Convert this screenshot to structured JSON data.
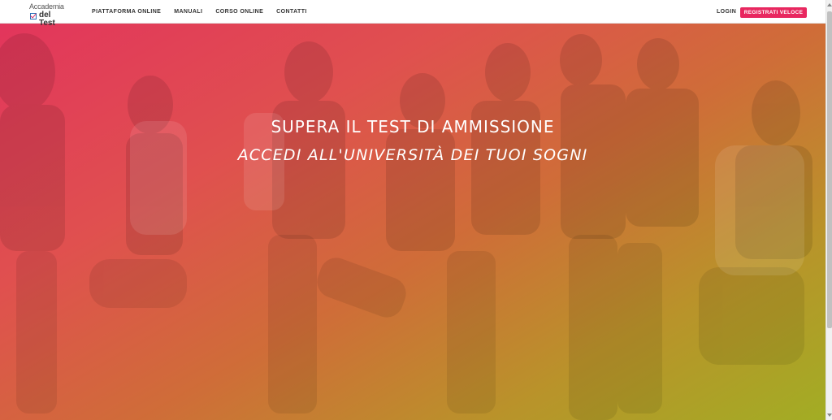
{
  "header": {
    "logo": {
      "line1": "Accademia",
      "line2": "del Test"
    },
    "nav": [
      {
        "label": "PIATTAFORMA ONLINE"
      },
      {
        "label": "MANUALI"
      },
      {
        "label": "CORSO ONLINE"
      },
      {
        "label": "CONTATTI"
      }
    ],
    "login_label": "LOGIN",
    "register_label": "REGISTRATI VELOCE"
  },
  "hero": {
    "title": "SUPERA IL TEST DI AMMISSIONE",
    "subtitle": "ACCEDI ALL'UNIVERSITÀ DEI TUOI SOGNI"
  },
  "colors": {
    "accent": "#e8275f",
    "gradient_start": "#e2355c",
    "gradient_end": "#a2ad24"
  }
}
